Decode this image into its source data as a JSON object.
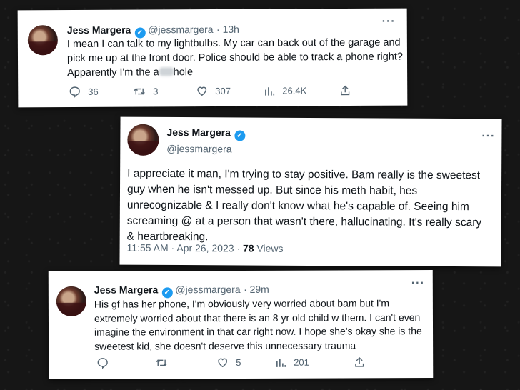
{
  "tweet1": {
    "name": "Jess Margera",
    "handle": "@jessmargera",
    "time": "· 13h",
    "line1": "I mean I can talk to my lightbulbs. My car can back out of the garage and",
    "line2": "pick me up at the front door. Police should be able to track a phone right?",
    "line3_start": "Apparently I'm the a",
    "line3_end": "hole",
    "replies": "36",
    "retweets": "3",
    "likes": "307",
    "views": "26.4K"
  },
  "tweet2": {
    "name": "Jess Margera",
    "handle": "@jessmargera",
    "line1": "I appreciate it man, I'm trying to stay positive. Bam really is the sweetest",
    "line2": "guy when he isn't messed up. But since his meth habit, hes",
    "line3": "unrecognizable & I really don't know what he's capable of. Seeing him",
    "line4": "screaming @ at a person that wasn't there, hallucinating. It's really scary",
    "line5": "& heartbreaking.",
    "timestamp": "11:55 AM · Apr 26, 2023 · ",
    "views_count": "78",
    "views_label": " Views"
  },
  "tweet3": {
    "name": "Jess Margera",
    "handle": "@jessmargera",
    "time": "· 29m",
    "line1": "His gf has her phone, I'm obviously very worried about bam but I'm",
    "line2": "extremely worried about that there is an 8 yr old child w them. I can't even",
    "line3": "imagine the environment in that car right now. I hope she's okay she is the",
    "line4": "sweetest kid, she doesn't deserve this unnecessary trauma",
    "likes": "5",
    "views": "201"
  },
  "more_icon": "···",
  "colors": {
    "verified": "#1d9bf0",
    "secondary": "#536471",
    "text": "#0f1419"
  }
}
